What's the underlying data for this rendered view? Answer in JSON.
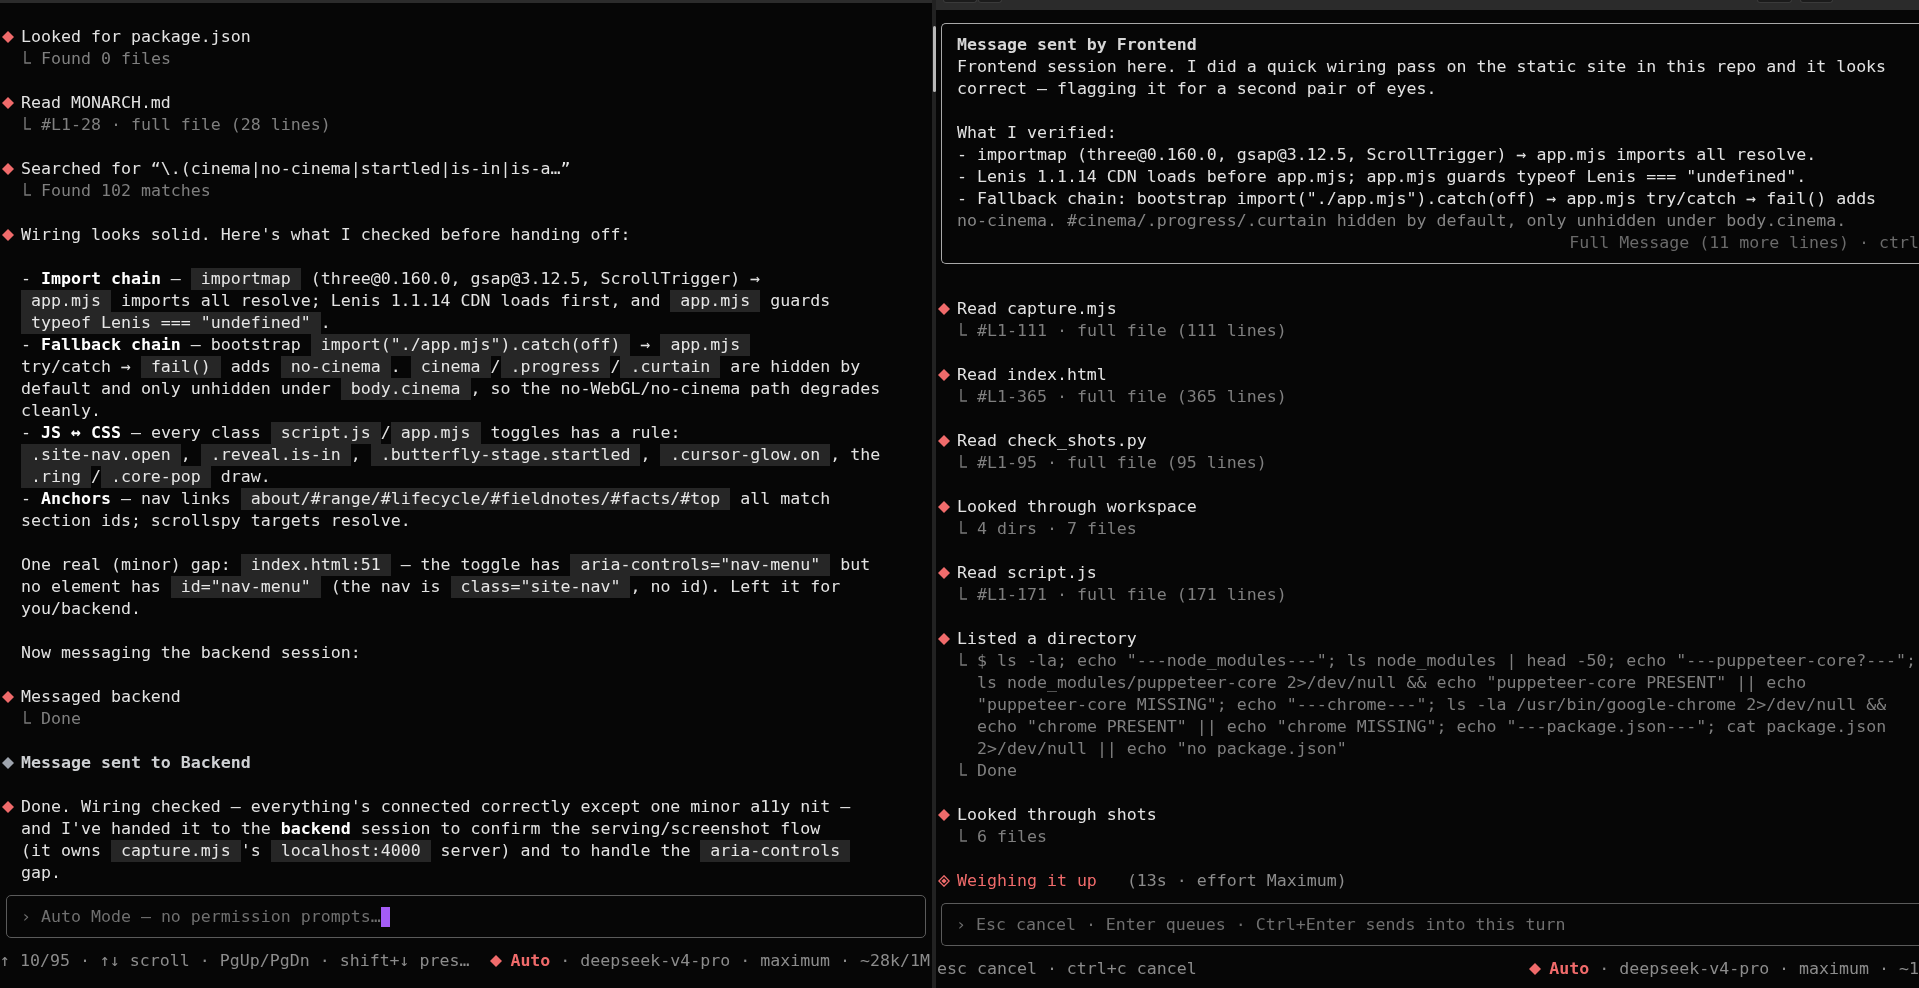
{
  "panes": [
    {
      "entries": [
        {
          "kind": "tool",
          "title": "Looked for package.json",
          "details": [
            {
              "lines": [
                "Found 0 files"
              ]
            }
          ]
        },
        {
          "kind": "tool",
          "title": "Read MONARCH.md",
          "details": [
            {
              "lines": [
                "#L1-28 · full file (28 lines)"
              ]
            }
          ]
        },
        {
          "kind": "tool",
          "title": "Searched for “\\.(cinema|no-cinema|startled|is-in|is-a…”",
          "details": [
            {
              "lines": [
                "Found 102 matches"
              ]
            }
          ]
        },
        {
          "kind": "reply",
          "groups": [
            {
              "paragraphs": [
                {
                  "lines": [
                    [
                      {
                        "kind": "text",
                        "text": "Wiring looks solid. Here's what I checked before handing off:"
                      }
                    ]
                  ]
                }
              ]
            },
            {
              "paragraphs": [
                {
                  "lines": [
                    [
                      {
                        "kind": "text",
                        "text": "- **Import chain** — "
                      },
                      {
                        "kind": "code",
                        "text": "importmap"
                      },
                      {
                        "kind": "text",
                        "text": " (three@0.160.0, gsap@3.12.5, ScrollTrigger) →"
                      }
                    ],
                    [
                      {
                        "kind": "code",
                        "text": "app.mjs"
                      },
                      {
                        "kind": "text",
                        "text": " imports all resolve; Lenis 1.1.14 CDN loads first, and "
                      },
                      {
                        "kind": "code",
                        "text": "app.mjs"
                      },
                      {
                        "kind": "text",
                        "text": " guards"
                      }
                    ],
                    [
                      {
                        "kind": "code",
                        "text": "typeof Lenis === \"undefined\""
                      },
                      {
                        "kind": "text",
                        "text": "."
                      }
                    ]
                  ]
                },
                {
                  "lines": [
                    [
                      {
                        "kind": "text",
                        "text": "- **Fallback chain** — bootstrap "
                      },
                      {
                        "kind": "code",
                        "text": "import(\"./app.mjs\").catch(off)"
                      },
                      {
                        "kind": "text",
                        "text": " → "
                      },
                      {
                        "kind": "code",
                        "text": "app.mjs"
                      }
                    ],
                    [
                      {
                        "kind": "text",
                        "text": "try/catch → "
                      },
                      {
                        "kind": "code",
                        "text": "fail()"
                      },
                      {
                        "kind": "text",
                        "text": " adds "
                      },
                      {
                        "kind": "code",
                        "text": "no-cinema"
                      },
                      {
                        "kind": "text",
                        "text": ". "
                      },
                      {
                        "kind": "code",
                        "text": "cinema"
                      },
                      {
                        "kind": "text",
                        "text": "/"
                      },
                      {
                        "kind": "code",
                        "text": ".progress"
                      },
                      {
                        "kind": "text",
                        "text": "/"
                      },
                      {
                        "kind": "code",
                        "text": ".curtain"
                      },
                      {
                        "kind": "text",
                        "text": " are hidden by"
                      }
                    ],
                    [
                      {
                        "kind": "text",
                        "text": "default and only unhidden under "
                      },
                      {
                        "kind": "code",
                        "text": "body.cinema"
                      },
                      {
                        "kind": "text",
                        "text": ", so the no-WebGL/no-cinema path degrades"
                      }
                    ],
                    [
                      {
                        "kind": "text",
                        "text": "cleanly."
                      }
                    ]
                  ]
                },
                {
                  "lines": [
                    [
                      {
                        "kind": "text",
                        "text": "- **JS ↔ CSS** — every class "
                      },
                      {
                        "kind": "code",
                        "text": "script.js"
                      },
                      {
                        "kind": "text",
                        "text": "/"
                      },
                      {
                        "kind": "code",
                        "text": "app.mjs"
                      },
                      {
                        "kind": "text",
                        "text": " toggles has a rule:"
                      }
                    ],
                    [
                      {
                        "kind": "code",
                        "text": ".site-nav.open"
                      },
                      {
                        "kind": "text",
                        "text": ", "
                      },
                      {
                        "kind": "code",
                        "text": ".reveal.is-in"
                      },
                      {
                        "kind": "text",
                        "text": ", "
                      },
                      {
                        "kind": "code",
                        "text": ".butterfly-stage.startled"
                      },
                      {
                        "kind": "text",
                        "text": ", "
                      },
                      {
                        "kind": "code",
                        "text": ".cursor-glow.on"
                      },
                      {
                        "kind": "text",
                        "text": ", the"
                      }
                    ],
                    [
                      {
                        "kind": "code",
                        "text": ".ring"
                      },
                      {
                        "kind": "text",
                        "text": "/"
                      },
                      {
                        "kind": "code",
                        "text": ".core-pop"
                      },
                      {
                        "kind": "text",
                        "text": " draw."
                      }
                    ]
                  ]
                },
                {
                  "lines": [
                    [
                      {
                        "kind": "text",
                        "text": "- **Anchors** — nav links "
                      },
                      {
                        "kind": "code",
                        "text": "about/#range/#lifecycle/#fieldnotes/#facts/#top"
                      },
                      {
                        "kind": "text",
                        "text": " all match"
                      }
                    ],
                    [
                      {
                        "kind": "text",
                        "text": "section ids; scrollspy targets resolve."
                      }
                    ]
                  ]
                }
              ]
            },
            {
              "paragraphs": [
                {
                  "lines": [
                    [
                      {
                        "kind": "text",
                        "text": "One real (minor) gap: "
                      },
                      {
                        "kind": "code",
                        "text": "index.html:51"
                      },
                      {
                        "kind": "text",
                        "text": " — the toggle has "
                      },
                      {
                        "kind": "code",
                        "text": "aria-controls=\"nav-menu\""
                      },
                      {
                        "kind": "text",
                        "text": " but"
                      }
                    ],
                    [
                      {
                        "kind": "text",
                        "text": "no element has "
                      },
                      {
                        "kind": "code",
                        "text": "id=\"nav-menu\""
                      },
                      {
                        "kind": "text",
                        "text": " (the nav is "
                      },
                      {
                        "kind": "code",
                        "text": "class=\"site-nav\""
                      },
                      {
                        "kind": "text",
                        "text": ", no id). Left it for"
                      }
                    ],
                    [
                      {
                        "kind": "text",
                        "text": "you/backend."
                      }
                    ]
                  ]
                }
              ]
            },
            {
              "paragraphs": [
                {
                  "lines": [
                    [
                      {
                        "kind": "text",
                        "text": "Now messaging the backend session:"
                      }
                    ]
                  ]
                }
              ]
            }
          ]
        },
        {
          "kind": "tool",
          "title": "Messaged backend",
          "details": [
            {
              "lines": [
                "Done"
              ]
            }
          ]
        },
        {
          "kind": "sent",
          "title": "Message sent to Backend"
        },
        {
          "kind": "reply",
          "groups": [
            {
              "paragraphs": [
                {
                  "lines": [
                    [
                      {
                        "kind": "text",
                        "text": "Done. Wiring checked — everything's connected correctly except one minor a11y nit —"
                      }
                    ],
                    [
                      {
                        "kind": "text",
                        "text": "and I've handed it to the **backend** session to confirm the serving/screenshot flow"
                      }
                    ],
                    [
                      {
                        "kind": "text",
                        "text": "(it owns "
                      },
                      {
                        "kind": "code",
                        "text": "capture.mjs"
                      },
                      {
                        "kind": "text",
                        "text": "'s "
                      },
                      {
                        "kind": "code",
                        "text": "localhost:4000"
                      },
                      {
                        "kind": "text",
                        "text": " server) and to handle the "
                      },
                      {
                        "kind": "code",
                        "text": "aria-controls"
                      }
                    ],
                    [
                      {
                        "kind": "text",
                        "text": "gap."
                      }
                    ]
                  ]
                }
              ]
            }
          ]
        }
      ],
      "input": {
        "prompt": "›",
        "placeholder": "Auto Mode — no permission prompts…",
        "focused": true
      },
      "status": {
        "hints": "↑ 10/95 · ↑↓ scroll · PgUp/PgDn · shift+↓ pres…",
        "mode": "Auto",
        "info": "· deepseek-v4-pro · maximum · ~28k/1M"
      }
    },
    {
      "entries": [
        {
          "kind": "message_box",
          "title": "Message sent by Frontend",
          "groups": [
            {
              "paragraphs": [
                {
                  "lines": [
                    "Frontend session here. I did a quick wiring pass on the static site in this repo and it looks",
                    "correct — flagging it for a second pair of eyes."
                  ]
                }
              ]
            },
            {
              "paragraphs": [
                {
                  "lines": [
                    "What I verified:"
                  ]
                },
                {
                  "lines": [
                    "- importmap (three@0.160.0, gsap@3.12.5, ScrollTrigger) → app.mjs imports all resolve."
                  ]
                },
                {
                  "lines": [
                    "- Lenis 1.1.14 CDN loads before app.mjs; app.mjs guards typeof Lenis === \"undefined\"."
                  ]
                },
                {
                  "lines": [
                    "- Fallback chain: bootstrap import(\"./app.mjs\").catch(off) → app.mjs try/catch → fail() adds",
                    "no-cinema. #cinema/.progress/.curtain hidden by default, only unhidden under body.cinema."
                  ]
                }
              ]
            }
          ],
          "faded_last_line": true,
          "footer": "Full Message (11 more lines) · ctrl"
        },
        {
          "kind": "tool",
          "title": "Read capture.mjs",
          "details": [
            {
              "lines": [
                "#L1-111 · full file (111 lines)"
              ]
            }
          ]
        },
        {
          "kind": "tool",
          "title": "Read index.html",
          "details": [
            {
              "lines": [
                "#L1-365 · full file (365 lines)"
              ]
            }
          ]
        },
        {
          "kind": "tool",
          "title": "Read check_shots.py",
          "details": [
            {
              "lines": [
                "#L1-95 · full file (95 lines)"
              ]
            }
          ]
        },
        {
          "kind": "tool",
          "title": "Looked through workspace",
          "details": [
            {
              "lines": [
                "4 dirs · 7 files"
              ]
            }
          ]
        },
        {
          "kind": "tool",
          "title": "Read script.js",
          "details": [
            {
              "lines": [
                "#L1-171 · full file (171 lines)"
              ]
            }
          ]
        },
        {
          "kind": "tool",
          "title": "Listed a directory",
          "details": [
            {
              "lines": [
                "$ ls -la; echo \"---node_modules---\"; ls node_modules | head -50; echo \"---puppeteer-core?---\";",
                "ls node_modules/puppeteer-core 2>/dev/null && echo \"puppeteer-core PRESENT\" || echo",
                "\"puppeteer-core MISSING\"; echo \"---chrome---\"; ls -la /usr/bin/google-chrome 2>/dev/null &&",
                "echo \"chrome PRESENT\" || echo \"chrome MISSING\"; echo \"---package.json---\"; cat package.json",
                "2>/dev/null || echo \"no package.json\""
              ]
            },
            {
              "lines": [
                "Done"
              ]
            }
          ]
        },
        {
          "kind": "tool",
          "title": "Looked through shots",
          "details": [
            {
              "lines": [
                "6 files"
              ]
            }
          ]
        },
        {
          "kind": "thinking",
          "title": "Weighing it up",
          "meta": "(13s · effort Maximum)"
        }
      ],
      "input": {
        "prompt": "›",
        "placeholder": "Esc cancel · Enter queues · Ctrl+Enter sends into this turn",
        "focused": false
      },
      "status": {
        "hints": "esc cancel · ctrl+c cancel",
        "mode": "Auto",
        "info": "· deepseek-v4-pro · maximum · ~1"
      }
    }
  ]
}
